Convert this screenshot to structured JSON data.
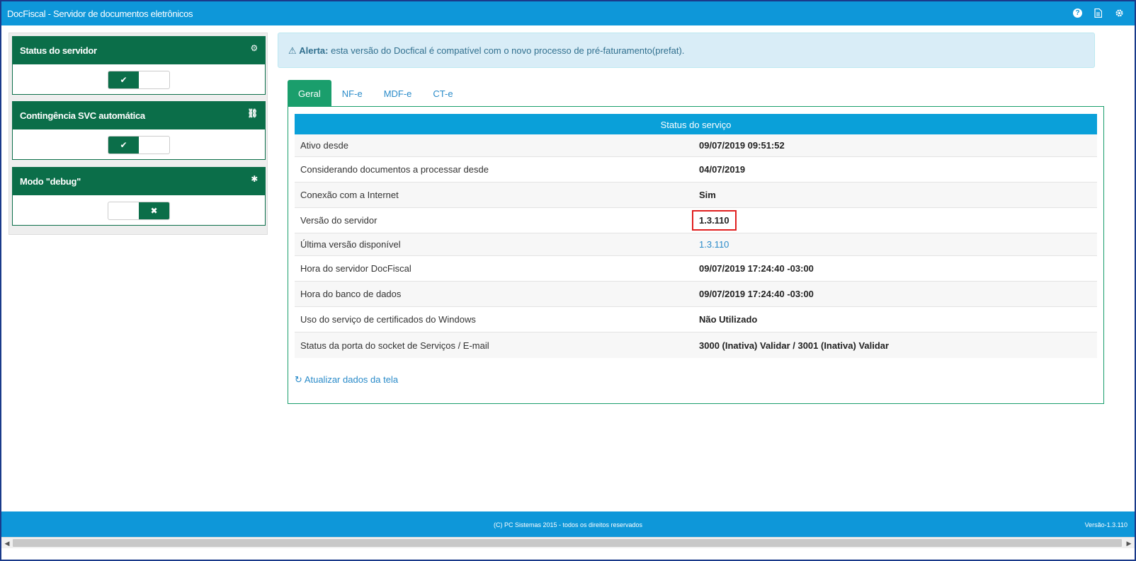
{
  "window": {
    "title": "DocFiscal - Servidor de documentos eletrônicos"
  },
  "topbar_icons": [
    "help-icon",
    "document-icon",
    "gear-icon"
  ],
  "sidebar": {
    "panels": [
      {
        "title": "Status do servidor",
        "icon": "gears-icon",
        "state": "on"
      },
      {
        "title": "Contingência SVC automática",
        "icon": "unlink-icon",
        "state": "on"
      },
      {
        "title": "Modo \"debug\"",
        "icon": "bug-icon",
        "state": "off"
      }
    ]
  },
  "alert": {
    "label": "Alerta:",
    "text": "esta versão do Docfical é compatível com o novo processo de pré-faturamento(prefat)."
  },
  "tabs": [
    "Geral",
    "NF-e",
    "MDF-e",
    "CT-e"
  ],
  "active_tab": "Geral",
  "service": {
    "header": "Status do serviço",
    "rows": [
      {
        "label": "Ativo desde",
        "value": "09/07/2019 09:51:52"
      },
      {
        "label": "Considerando documentos a processar desde",
        "value": "04/07/2019"
      },
      {
        "label": "Conexão com a Internet",
        "value": "Sim"
      },
      {
        "label": "Versão do servidor",
        "value": "1.3.110"
      },
      {
        "label": "Última versão disponível",
        "value": "1.3.110"
      },
      {
        "label": "Hora do servidor DocFiscal",
        "value": "09/07/2019 17:24:40 -03:00"
      },
      {
        "label": "Hora do banco de dados",
        "value": "09/07/2019 17:24:40 -03:00"
      },
      {
        "label": "Uso do serviço de certificados do Windows",
        "value": "Não Utilizado"
      },
      {
        "label": "Status da porta do socket de Serviços / E-mail",
        "value": "3000 (Inativa) Validar / 3001 (Inativa) Validar"
      }
    ],
    "refresh_label": "Atualizar dados da tela"
  },
  "footer": {
    "copyright": "(C) PC Sistemas 2015 - todos os direitos reservados",
    "version": "Versão-1.3.110"
  },
  "colors": {
    "topbar": "#0e97d9",
    "panel": "#0b6e49",
    "tab_active": "#1a9e6c",
    "highlight": "#e02020"
  }
}
